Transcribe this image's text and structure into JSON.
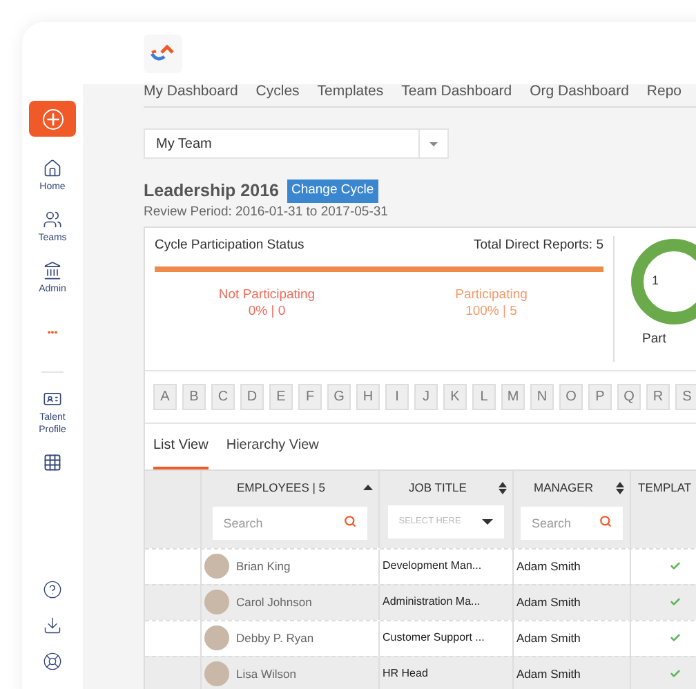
{
  "sidebar": {
    "items": [
      {
        "kind": "add"
      },
      {
        "kind": "home",
        "label": "Home"
      },
      {
        "kind": "teams",
        "label": "Teams"
      },
      {
        "kind": "admin",
        "label": "Admin"
      },
      {
        "kind": "more",
        "label": "•••"
      },
      {
        "kind": "divider"
      },
      {
        "kind": "talent",
        "label": "Talent Profile"
      },
      {
        "kind": "apps"
      }
    ],
    "bottom": [
      {
        "kind": "help"
      },
      {
        "kind": "download"
      },
      {
        "kind": "support"
      }
    ]
  },
  "nav": [
    {
      "label": "My Dashboard"
    },
    {
      "label": "Cycles"
    },
    {
      "label": "Templates"
    },
    {
      "label": "Team Dashboard"
    },
    {
      "label": "Org Dashboard"
    },
    {
      "label": "Repo"
    }
  ],
  "team_select": {
    "value": "My Team"
  },
  "cycle": {
    "title": "Leadership 2016",
    "button": "Change Cycle",
    "period": "Review Period: 2016-01-31 to 2017-05-31"
  },
  "status_card": {
    "title": "Cycle Participation Status",
    "total": "Total Direct Reports: 5",
    "level": 1,
    "not_participating": {
      "label": "Not Participating",
      "value": "0% | 0"
    },
    "participating": {
      "label": "Participating",
      "value": "100% | 5"
    },
    "donut": {
      "center": "1",
      "caption": "Part"
    }
  },
  "letters": [
    "A",
    "B",
    "C",
    "D",
    "E",
    "F",
    "G",
    "H",
    "I",
    "J",
    "K",
    "L",
    "M",
    "N",
    "O",
    "P",
    "Q",
    "R",
    "S"
  ],
  "view_tabs": [
    {
      "label": "List View",
      "selected": true
    },
    {
      "label": "Hierarchy View",
      "selected": false
    }
  ],
  "table": {
    "columns": [
      {
        "label": "EMPLOYEES | 5",
        "kind": "sort_up",
        "filter": {
          "kind": "search",
          "placeholder": "Search"
        }
      },
      {
        "label": "JOB TITLE",
        "kind": "sort_both",
        "filter": {
          "kind": "select",
          "placeholder": "SELECT HERE"
        }
      },
      {
        "label": "MANAGER",
        "kind": "sort_both",
        "filter": {
          "kind": "search",
          "placeholder": "Search"
        }
      },
      {
        "label": "TEMPLAT",
        "kind": "plain",
        "filter": {
          "kind": "none"
        }
      }
    ],
    "rows": [
      {
        "name": "Brian King",
        "job": "Development Man...",
        "manager": "Adam Smith",
        "template": true
      },
      {
        "name": "Carol Johnson",
        "job": "Administration Ma...",
        "manager": "Adam Smith",
        "template": true
      },
      {
        "name": "Debby P. Ryan",
        "job": "Customer Support ...",
        "manager": "Adam Smith",
        "template": true
      },
      {
        "name": "Lisa Wilson",
        "job": "HR Head",
        "manager": "Adam Smith",
        "template": true
      }
    ]
  }
}
